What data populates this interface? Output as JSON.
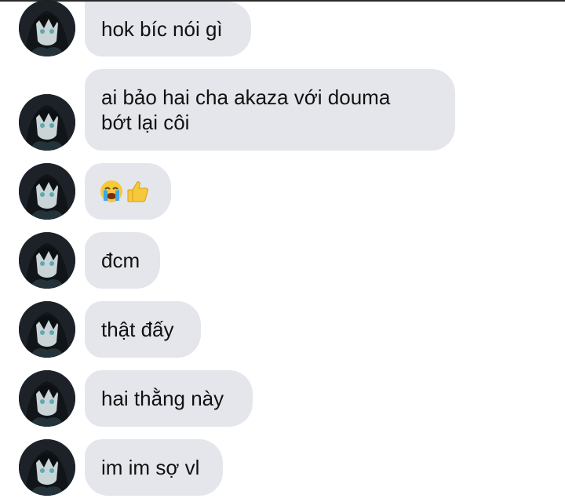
{
  "messages": [
    {
      "text": "hok bíc nói gì"
    },
    {
      "text": "ai bảo hai cha akaza với douma bớt lại côi"
    },
    {
      "emojis": [
        "loudly-crying-face",
        "thumbs-up"
      ]
    },
    {
      "text": "đcm"
    },
    {
      "text": "thật đấy"
    },
    {
      "text": "hai thằng này"
    },
    {
      "text": "im im sợ vl"
    }
  ],
  "colors": {
    "bubble": "#e4e6eb",
    "text": "#111111",
    "avatar_bg": "#1c2227",
    "avatar_accent": "#5fa9b2"
  }
}
